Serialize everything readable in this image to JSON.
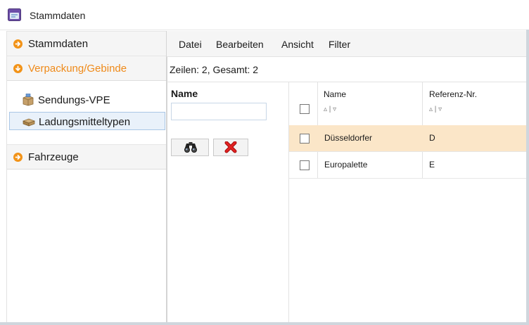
{
  "window": {
    "title": "Stammdaten"
  },
  "sidebar": {
    "sections": [
      {
        "label": "Stammdaten",
        "icon": "circle-arrow-right-icon"
      },
      {
        "label": "Verpackung/Gebinde",
        "icon": "circle-arrow-down-icon",
        "active": true
      },
      {
        "label": "Fahrzeuge",
        "icon": "circle-arrow-right-icon"
      }
    ],
    "items": [
      {
        "label": "Sendungs-VPE",
        "icon": "package-icon"
      },
      {
        "label": "Ladungsmitteltypen",
        "icon": "pallet-icon",
        "selected": true
      }
    ]
  },
  "menu": {
    "items": [
      "Datei",
      "Bearbeiten",
      "Ansicht",
      "Filter"
    ]
  },
  "status": {
    "rows": "Zeilen: 2, Gesamt: 2"
  },
  "filter": {
    "label": "Name",
    "value": "",
    "search_icon": "binoculars-icon",
    "clear_icon": "red-x-icon"
  },
  "table": {
    "columns": [
      "Name",
      "Referenz-Nr."
    ],
    "sort_glyph": "▵ | ▿",
    "rows": [
      {
        "name": "Düsseldorfer",
        "ref": "D",
        "selected": true
      },
      {
        "name": "Europalette",
        "ref": "E",
        "selected": false
      }
    ]
  },
  "colors": {
    "accent": "#f29318",
    "selection": "#fbe6c8",
    "nav_selected": "#e9f1fa"
  }
}
